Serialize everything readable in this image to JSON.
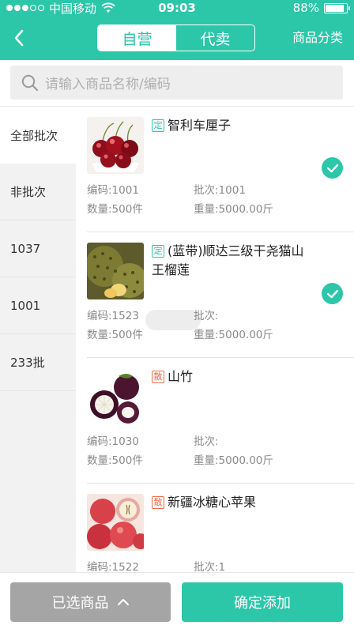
{
  "status_bar": {
    "carrier": "中国移动",
    "time": "09:03",
    "battery_text": "88%",
    "battery_level": 0.88
  },
  "nav": {
    "segments": [
      "自营",
      "代卖"
    ],
    "active_segment": 0,
    "right_action": "商品分类"
  },
  "search": {
    "placeholder": "请输入商品名称/编码"
  },
  "sidebar": {
    "items": [
      "全部批次",
      "非批次",
      "1037",
      "1001",
      "233批"
    ],
    "active_index": 0
  },
  "products": [
    {
      "tag": "定",
      "tag_type": "ding",
      "name": "智利车厘子",
      "code": "编码:1001",
      "batch": "批次:1001",
      "quantity": "数量:500件",
      "weight": "重量:5000.00斤",
      "checked": true,
      "image": "cherries"
    },
    {
      "tag": "定",
      "tag_type": "ding",
      "name": "(蓝带)顺达三级干尧猫山王榴莲",
      "code": "编码:1523",
      "batch": "批次:",
      "quantity": "数量:500件",
      "weight": "重量:5000.00斤",
      "checked": true,
      "image": "durian"
    },
    {
      "tag": "散",
      "tag_type": "san",
      "name": "山竹",
      "code": "编码:1030",
      "batch": "批次:",
      "quantity": "数量:500件",
      "weight": "重量:5000.00斤",
      "checked": false,
      "image": "mangosteen"
    },
    {
      "tag": "散",
      "tag_type": "san",
      "name": "新疆冰糖心苹果",
      "code": "编码:1522",
      "batch": "批次:1",
      "quantity": "",
      "weight": "",
      "checked": false,
      "image": "apples"
    }
  ],
  "bottom": {
    "selected_label": "已选商品",
    "confirm_label": "确定添加"
  },
  "colors": {
    "accent": "#2cc6a9",
    "tag_scatter": "#ee6a4a",
    "disabled_button": "#a5a5a5"
  }
}
